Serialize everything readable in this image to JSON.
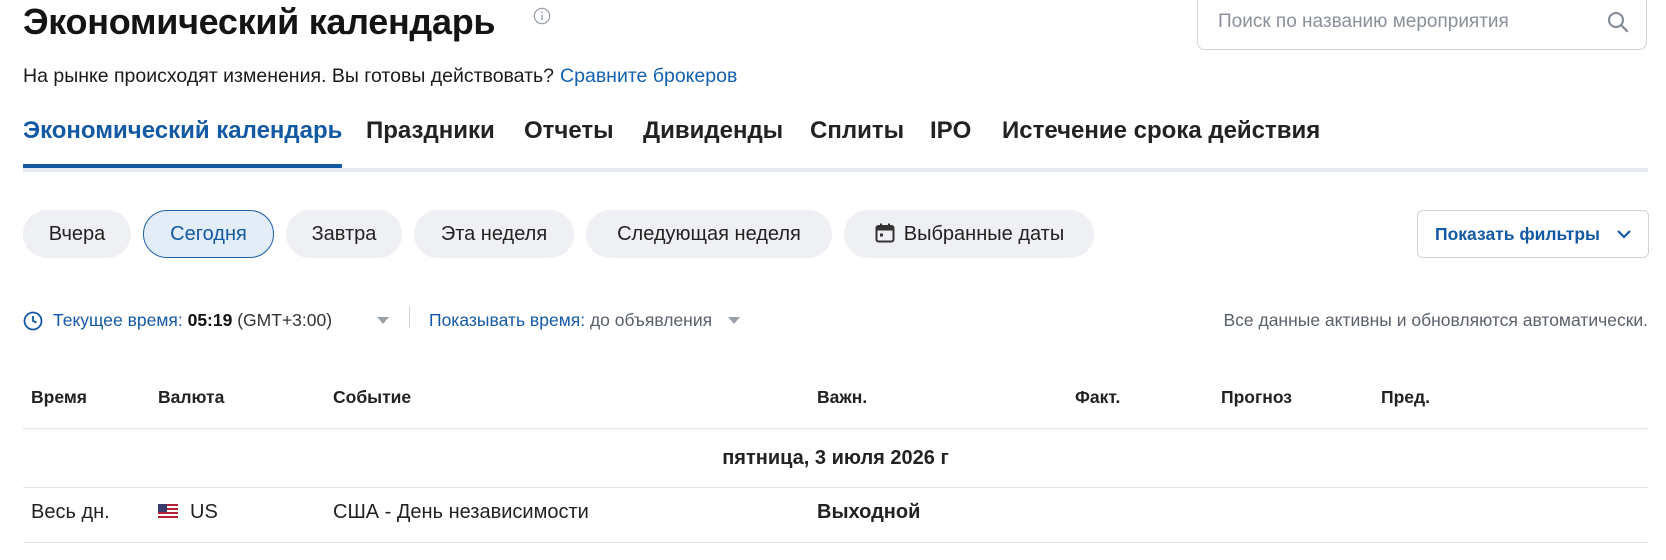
{
  "header": {
    "title": "Экономический календарь",
    "search_placeholder": "Поиск по названию мероприятия"
  },
  "promo": {
    "text": "На рынке происходят изменения. Вы готовы действовать?",
    "link": "Сравните брокеров"
  },
  "tabs": [
    {
      "label": "Экономический календарь",
      "active": true
    },
    {
      "label": "Праздники"
    },
    {
      "label": "Отчеты"
    },
    {
      "label": "Дивиденды"
    },
    {
      "label": "Сплиты"
    },
    {
      "label": "IPO"
    },
    {
      "label": "Истечение срока действия"
    }
  ],
  "date_filters": [
    {
      "label": "Вчера"
    },
    {
      "label": "Сегодня",
      "active": true
    },
    {
      "label": "Завтра"
    },
    {
      "label": "Эта неделя"
    },
    {
      "label": "Следующая неделя"
    },
    {
      "label": "Выбранные даты",
      "icon": "calendar-icon"
    }
  ],
  "filters_button": "Показать фильтры",
  "timebar": {
    "current_time_label": "Текущее время:",
    "current_time": "05:19",
    "timezone": "(GMT+3:00)",
    "show_time_label": "Показывать время:",
    "show_time_value": "до объявления",
    "note": "Все данные активны и обновляются автоматически."
  },
  "table": {
    "columns": [
      "Время",
      "Валюта",
      "Событие",
      "Важн.",
      "Факт.",
      "Прогноз",
      "Пред."
    ],
    "date_header": "пятница, 3 июля 2026 г",
    "rows": [
      {
        "time": "Весь дн.",
        "flag": "us-flag-icon",
        "currency": "US",
        "event": "США - День независимости",
        "importance": "Выходной",
        "actual": "",
        "forecast": "",
        "previous": ""
      }
    ]
  },
  "colors": {
    "accent": "#1359a3",
    "link": "#1460b0",
    "pill_bg": "#eef0f3"
  }
}
